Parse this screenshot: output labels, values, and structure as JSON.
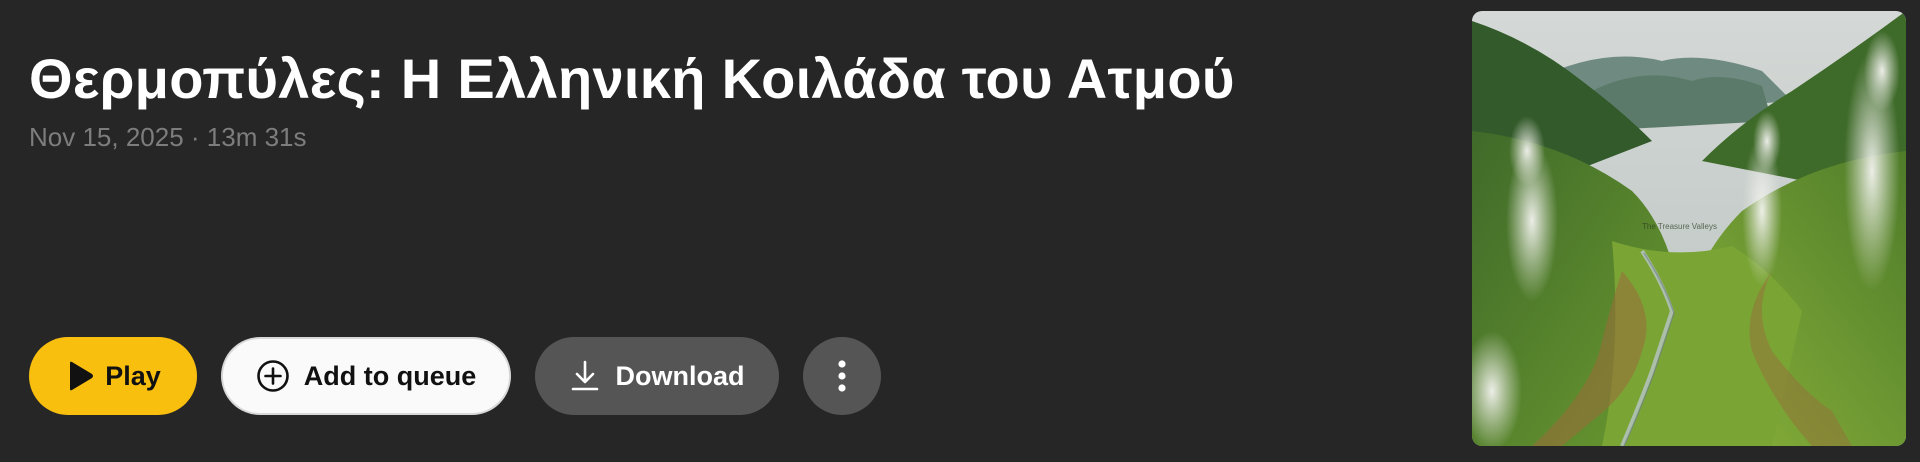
{
  "episode": {
    "title": "Θερμοπύλες: Η Ελληνική Κοιλάδα του Ατμού",
    "meta": "Nov 15, 2025 · 13m 31s",
    "artwork_watermark": "The Treasure Valleys"
  },
  "actions": {
    "play_label": "Play",
    "queue_label": "Add to queue",
    "download_label": "Download",
    "more_icon": "more-vertical-icon"
  },
  "colors": {
    "background": "#262626",
    "play_accent": "#f9bf0f",
    "secondary_button": "#555555",
    "meta_text": "#7d7d7d"
  }
}
